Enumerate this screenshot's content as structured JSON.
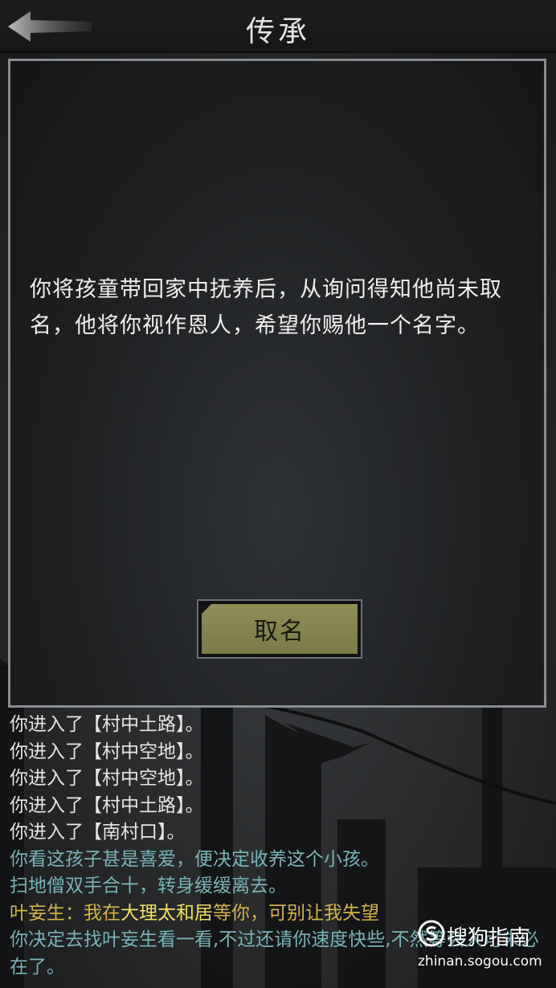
{
  "header": {
    "title": "传承",
    "back_icon": "back-arrow-icon"
  },
  "dialog": {
    "message": "你将孩童带回家中抚养后，从询问得知他尚未取名，他将你视作恩人，希望你赐他一个名字。",
    "button_label": "取名"
  },
  "log": {
    "lines": [
      "你进入了【村中土路】。",
      "你进入了【村中空地】。",
      "你进入了【村中空地】。",
      "你进入了【村中土路】。",
      "你进入了【南村口】。",
      "你看这孩子甚是喜爱，便决定收养这个小孩。",
      "扫地僧双手合十，转身缓缓离去。"
    ],
    "dialog_line": {
      "prefix": "叶妄生：我在",
      "highlight": "大理太和居",
      "suffix": "等你，可别让我失望"
    },
    "last_line": "你决定去找叶妄生看一看,不过还请你速度快些,不然等会人可未必在了。"
  },
  "watermark": {
    "brand": "搜狗指南",
    "url": "zhinan.sogou.com"
  },
  "colors": {
    "log_default": "#e6e6e6",
    "log_teal": "#7ab3b8",
    "log_gold": "#d4b448",
    "button_fill": "#858250"
  }
}
